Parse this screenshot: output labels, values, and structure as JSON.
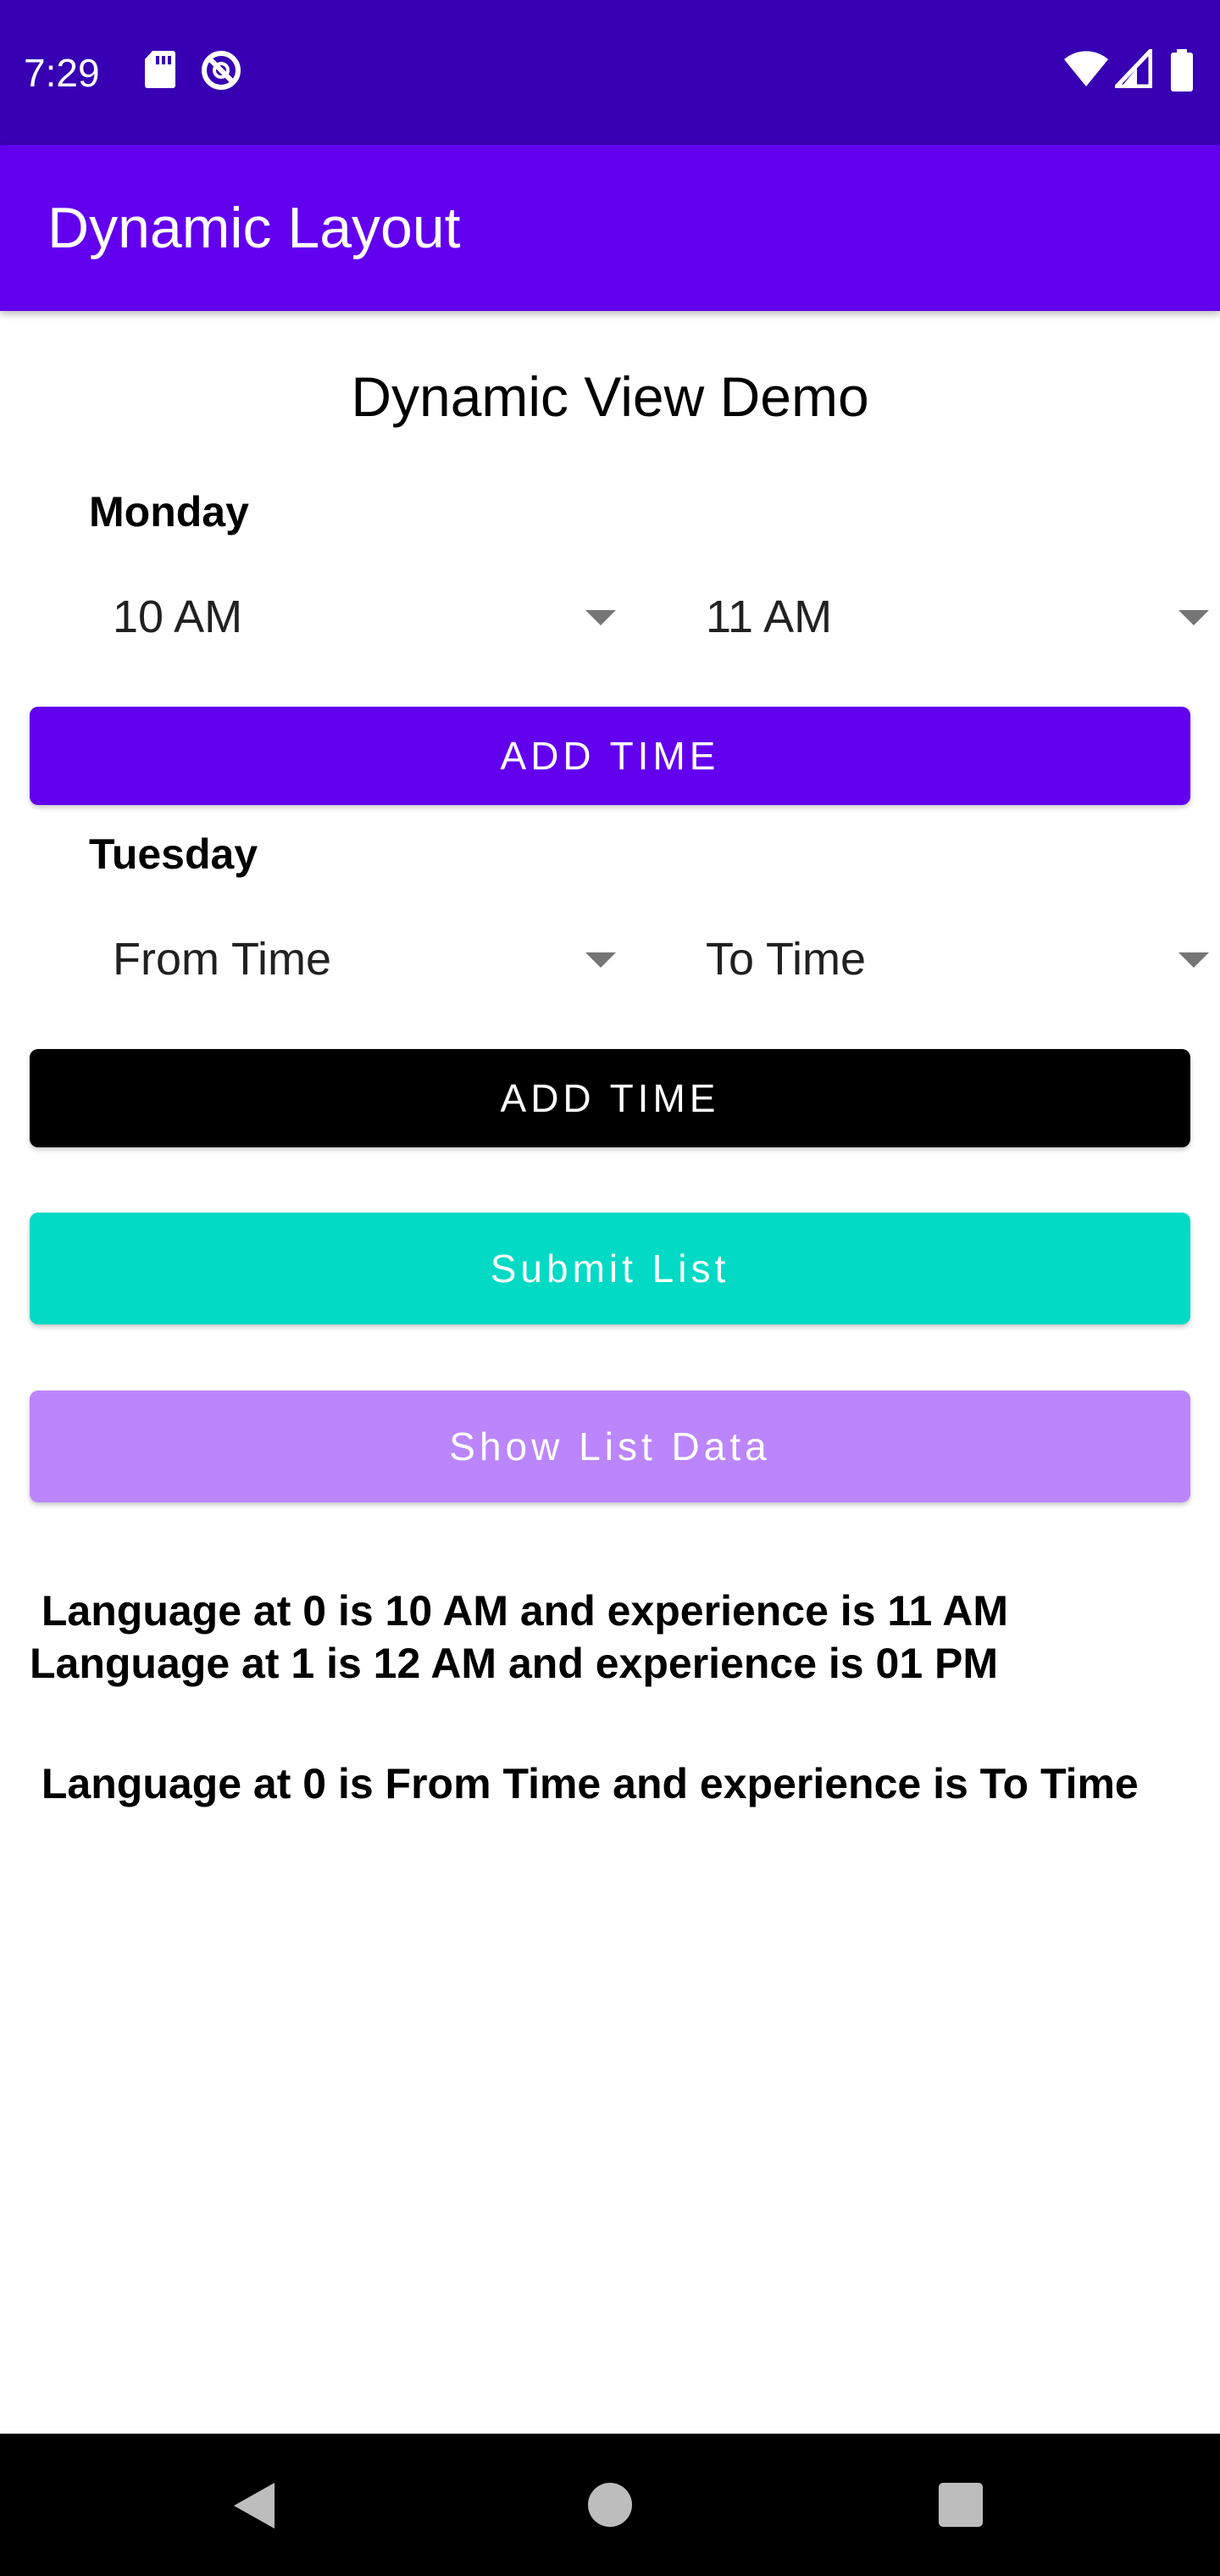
{
  "status_bar": {
    "time": "7:29",
    "icons": [
      "sd-card-icon",
      "no-sync-icon",
      "wifi-icon",
      "cellular-signal-icon",
      "battery-icon"
    ]
  },
  "app_bar": {
    "title": "Dynamic Layout"
  },
  "main": {
    "demo_title": "Dynamic View Demo",
    "days": [
      {
        "label": "Monday",
        "from_value": "10 AM",
        "to_value": "11 AM",
        "add_button_label": "ADD TIME"
      },
      {
        "label": "Tuesday",
        "from_value": "From Time",
        "to_value": "To Time",
        "add_button_label": "ADD TIME"
      }
    ],
    "submit_button_label": "Submit List",
    "show_button_label": "Show List Data",
    "results": [
      " Language at 0 is 10 AM and experience is 11 AM\nLanguage at 1 is 12 AM and experience is 01 PM",
      " Language at 0 is From Time and experience is To Time"
    ]
  },
  "colors": {
    "status_bar": "#3700b3",
    "app_bar": "#6200ee",
    "add_button_monday": "#6200ee",
    "add_button_tuesday": "#000000",
    "submit_button": "#03dac5",
    "show_button": "#bb86fc",
    "nav_bar": "#000000"
  },
  "nav_bar": {
    "icons": [
      "back-icon",
      "home-icon",
      "recents-icon"
    ]
  }
}
